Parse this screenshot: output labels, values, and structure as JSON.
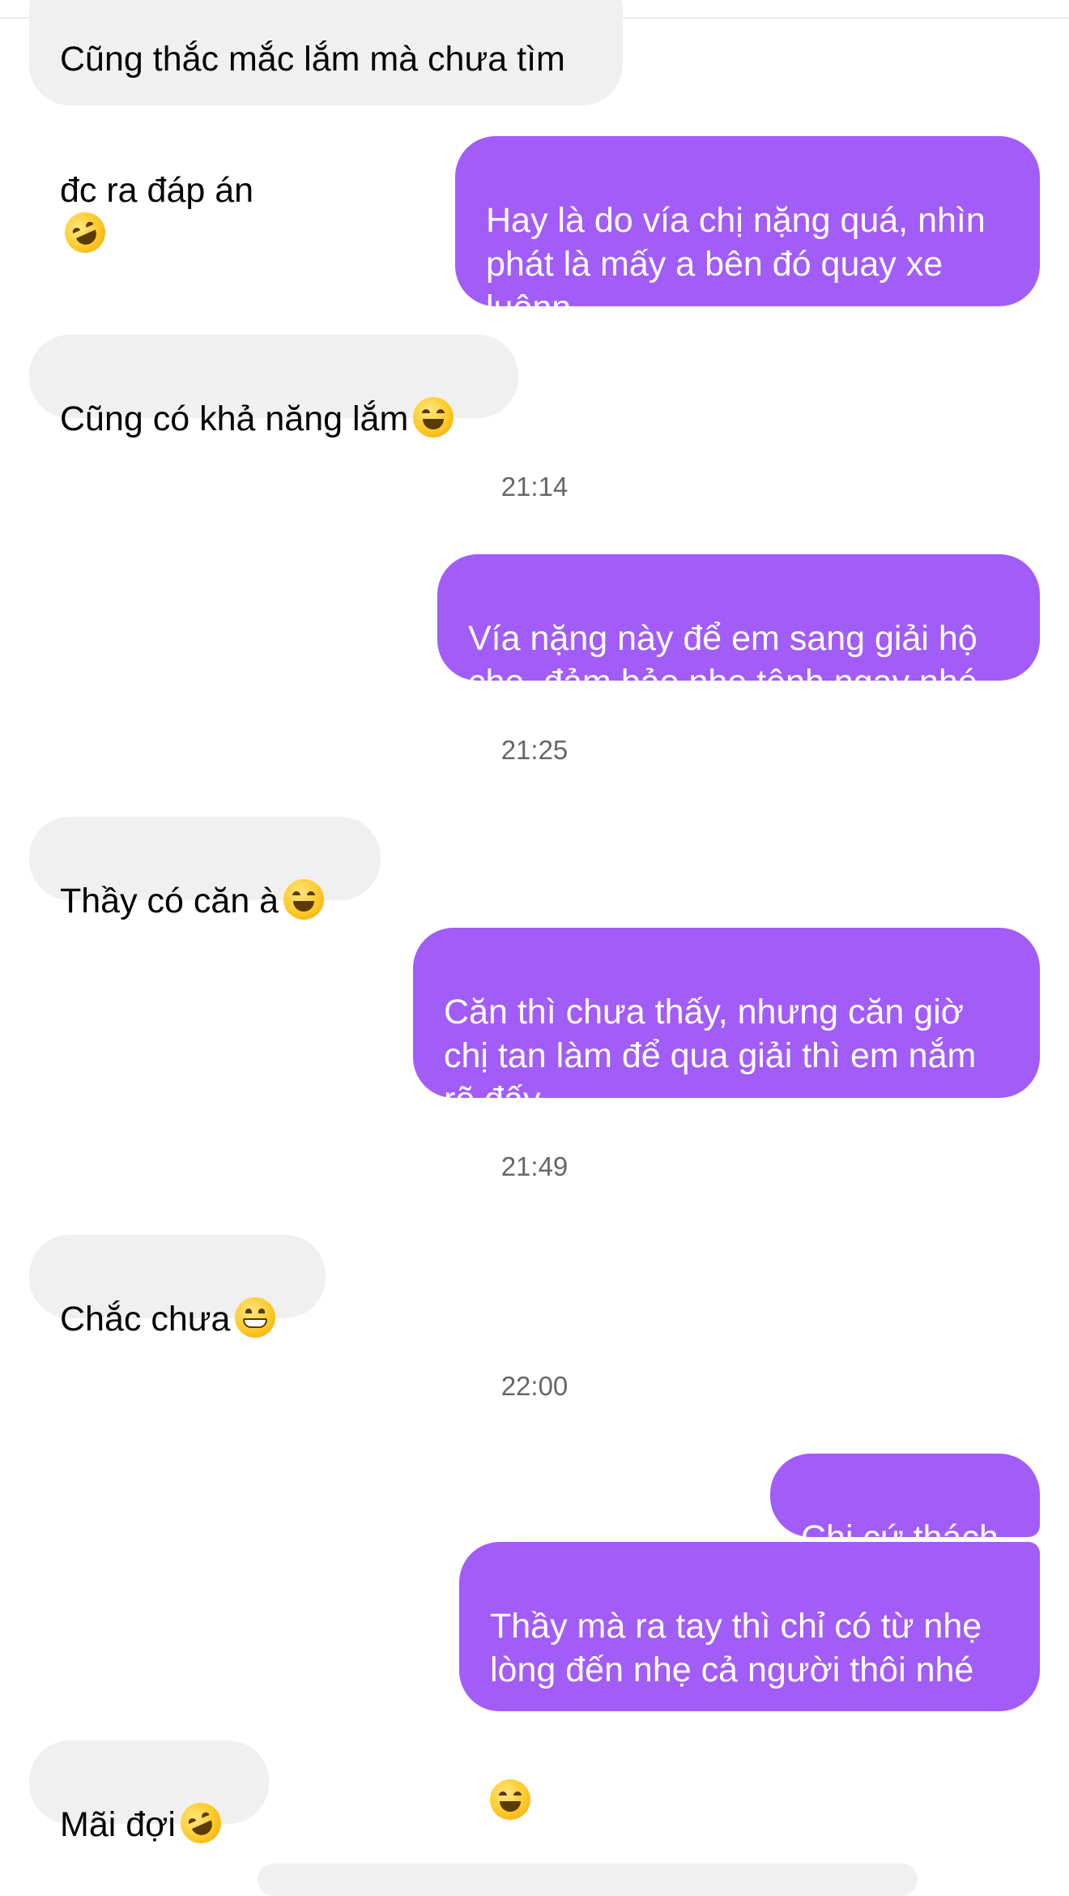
{
  "messages": [
    {
      "dir": "in",
      "line1": "Cũng thắc mắc lắm mà chưa tìm",
      "line2": "đc ra đáp án",
      "emoji": "rolling-on-floor-laughing-icon"
    },
    {
      "dir": "out",
      "text": "Hay là do vía chị nặng quá, nhìn\nphát là mấy a bên đó quay xe\nluônn"
    },
    {
      "dir": "in",
      "text": "Cũng có khả năng lắm",
      "emoji": "tears-of-joy-icon"
    },
    {
      "time": "21:14"
    },
    {
      "dir": "out",
      "text": "Vía nặng này để em sang giải hộ\ncho, đảm bảo nhẹ tênh ngay nhé"
    },
    {
      "time": "21:25"
    },
    {
      "dir": "in",
      "text": "Thầy có căn à",
      "emoji": "tears-of-joy-icon"
    },
    {
      "dir": "out",
      "text": "Căn thì chưa thấy, nhưng căn giờ\nchị tan làm để qua giải thì em nắm\nrõ đấy"
    },
    {
      "time": "21:49"
    },
    {
      "dir": "in",
      "text": "Chắc chưa",
      "emoji": "grinning-face-icon"
    },
    {
      "time": "22:00"
    },
    {
      "dir": "out",
      "text": "Chị cứ thách"
    },
    {
      "dir": "out",
      "text": "Thầy mà ra tay thì chỉ có từ nhẹ\nlòng đến nhẹ cả người thôi nhé",
      "emoji": "tears-of-joy-icon"
    },
    {
      "dir": "in",
      "text": "Mãi đợi",
      "emoji": "rolling-on-floor-laughing-icon"
    }
  ],
  "colors": {
    "outgoing_bubble": "#a25cf8",
    "incoming_bubble": "#f0f0f0",
    "timestamp": "#65676b"
  }
}
